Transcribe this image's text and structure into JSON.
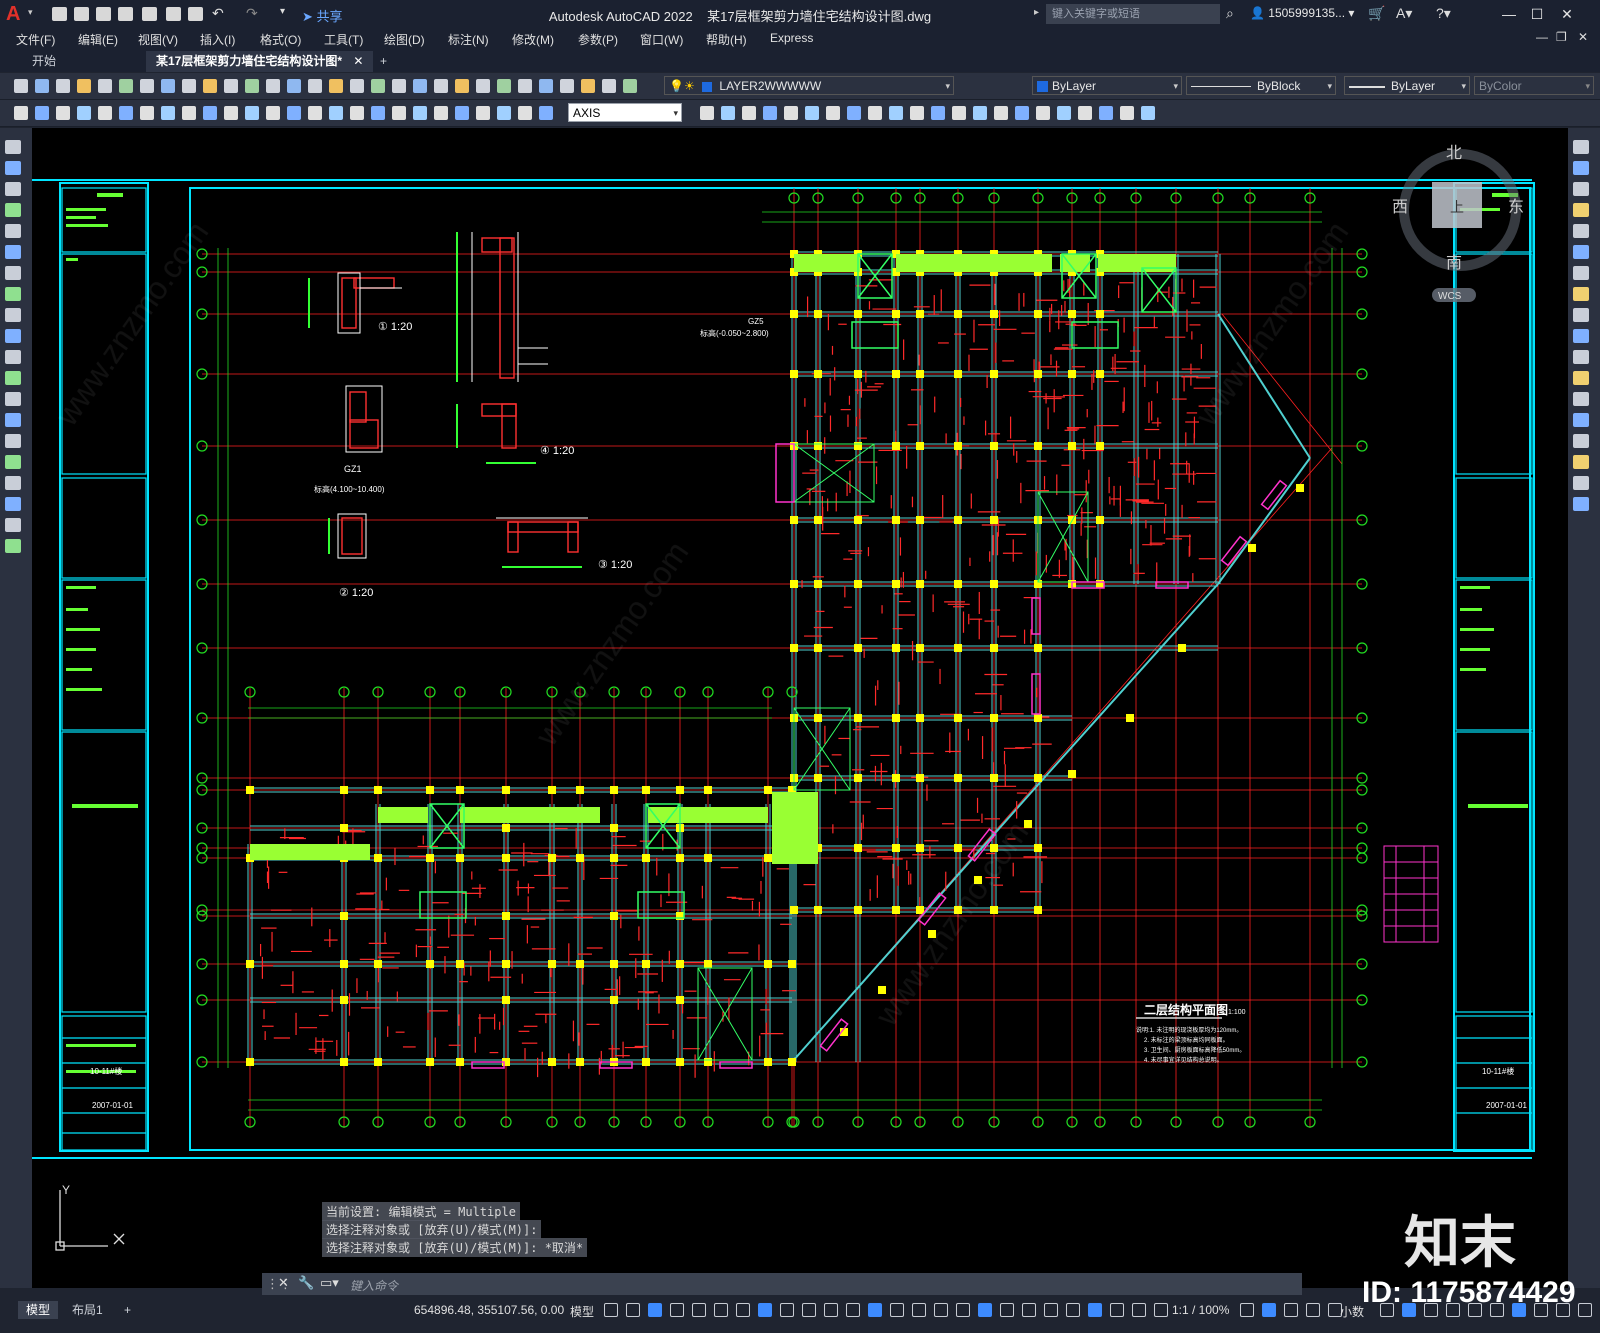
{
  "window": {
    "app_title": "Autodesk AutoCAD 2022",
    "file_title": "某17层框架剪力墙住宅结构设计图.dwg",
    "share_label": "共享",
    "search_placeholder": "键入关键字或短语",
    "user": "1505999135...",
    "min": "—",
    "max": "☐",
    "close": "✕"
  },
  "menu": [
    "文件(F)",
    "编辑(E)",
    "视图(V)",
    "插入(I)",
    "格式(O)",
    "工具(T)",
    "绘图(D)",
    "标注(N)",
    "修改(M)",
    "参数(P)",
    "窗口(W)",
    "帮助(H)",
    "Express"
  ],
  "tabs": {
    "start": "开始",
    "active": "某17层框架剪力墙住宅结构设计图*",
    "close": "✕",
    "add": "+"
  },
  "toolbar": {
    "layer": "LAYER2WWWWW",
    "color": "ByLayer",
    "linetype": "ByBlock",
    "lineweight": "ByLayer",
    "plotstyle": "ByColor",
    "dimstyle": "AXIS"
  },
  "viewcube": {
    "north": "北",
    "south": "南",
    "west": "西",
    "east": "东",
    "top": "上",
    "wcs": "WCS"
  },
  "drawing": {
    "plan_title": "二层结构平面图",
    "plan_scale": "1:100",
    "detail_labels": [
      "① 1:20",
      "② 1:20",
      "③ 1:20",
      "④ 1:20"
    ],
    "gz_label": "GZ1",
    "gz_elev": "标高(4.100~10.400)",
    "gz5_label": "GZ5",
    "gz5_elev": "标高(-0.050~2.800)",
    "sheet_no": "10-11#楼",
    "date": "2007-01-01",
    "notes": [
      "说明:1. 未注明的现浇板厚均为120mm。",
      "2. 未标注的梁顶标高均同板面。",
      "3. 卫生间、厨房板面标高降低50mm。",
      "4. 未尽事宜详见结构总说明。"
    ],
    "ucs_x": "X",
    "ucs_y": "Y"
  },
  "command": {
    "history": [
      "当前设置: 编辑模式 = Multiple",
      "选择注释对象或 [放弃(U)/模式(M)]:",
      "选择注释对象或 [放弃(U)/模式(M)]: *取消*"
    ],
    "placeholder": "键入命令"
  },
  "status": {
    "model_tab": "模型",
    "layout_tab": "布局1",
    "add_tab": "+",
    "coords": "654896.48, 355107.56, 0.00",
    "model": "模型",
    "scale": "1:1 / 100%",
    "units": "小数"
  },
  "watermark": {
    "brand": "知末",
    "id": "ID: 1175874429",
    "site": "www.znzmo.com"
  },
  "colors": {
    "accent_cyan": "#00ffff",
    "grid_red": "#ff2020",
    "wall_green": "#99ff33",
    "column_yellow": "#ffff00",
    "magenta": "#ff33cc"
  }
}
